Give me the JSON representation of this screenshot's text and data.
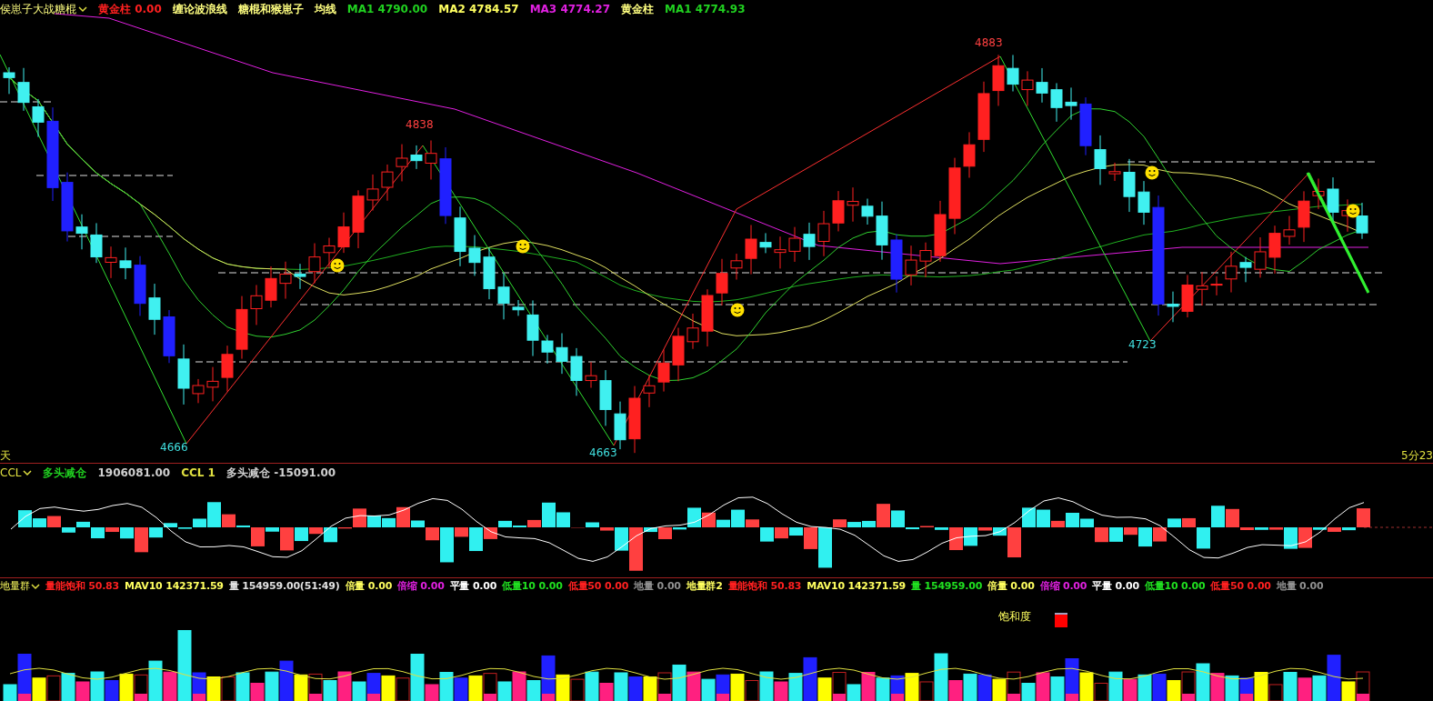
{
  "main_panel": {
    "selector": "侯崽子大战糖棍",
    "legend": [
      {
        "text": "黄金柱 0.00",
        "color": "#ff2020"
      },
      {
        "text": "缠论波浪线",
        "color": "#ffff80"
      },
      {
        "text": "糖棍和猴崽子",
        "color": "#ffff80"
      },
      {
        "text": "均线",
        "color": "#ffff80"
      },
      {
        "text": "MA1 4790.00",
        "color": "#20d020"
      },
      {
        "text": "MA2 4784.57",
        "color": "#ffff60"
      },
      {
        "text": "MA3 4774.27",
        "color": "#e020e0"
      },
      {
        "text": "黄金柱",
        "color": "#ffff80"
      },
      {
        "text": "MA1 4774.93",
        "color": "#20d020"
      }
    ],
    "price_labels": [
      {
        "text": "4883",
        "color": "#ff4040"
      },
      {
        "text": "4838",
        "color": "#ff4040"
      },
      {
        "text": "4666",
        "color": "#40e0e0"
      },
      {
        "text": "4663",
        "color": "#40e0e0"
      },
      {
        "text": "4723",
        "color": "#40e0e0"
      }
    ],
    "period_label": "天",
    "timer": "5分23"
  },
  "ccl_panel": {
    "selector": "CCL",
    "legend": [
      {
        "text": "多头减仓",
        "color": "#20d020"
      },
      {
        "text": "1906081.00",
        "color": "#d0d0d0"
      },
      {
        "text": "CCL 1",
        "color": "#e0e040"
      },
      {
        "text": "多头减仓 -15091.00",
        "color": "#d0d0d0"
      }
    ]
  },
  "volume_panel": {
    "selector": "地量群",
    "legend": [
      {
        "text": "量能饱和 50.83",
        "color": "#ff2020"
      },
      {
        "text": "MAV10 142371.59",
        "color": "#ffff60"
      },
      {
        "text": "量 154959.00(51:49)",
        "color": "#e0e0e0"
      },
      {
        "text": "倍量 0.00",
        "color": "#ffff60"
      },
      {
        "text": "倍缩 0.00",
        "color": "#e020e0"
      },
      {
        "text": "平量 0.00",
        "color": "#ffffff"
      },
      {
        "text": "低量10 0.00",
        "color": "#20e020"
      },
      {
        "text": "低量50 0.00",
        "color": "#ff2020"
      },
      {
        "text": "地量 0.00",
        "color": "#909090"
      },
      {
        "text": "地量群2",
        "color": "#ffff60"
      },
      {
        "text": "量能饱和 50.83",
        "color": "#ff2020"
      },
      {
        "text": "MAV10 142371.59",
        "color": "#ffff60"
      },
      {
        "text": "量 154959.00",
        "color": "#20e020"
      },
      {
        "text": "倍量 0.00",
        "color": "#ffff60"
      },
      {
        "text": "倍缩 0.00",
        "color": "#e020e0"
      },
      {
        "text": "平量 0.00",
        "color": "#ffffff"
      },
      {
        "text": "低量10 0.00",
        "color": "#20e020"
      },
      {
        "text": "低量50 0.00",
        "color": "#ff2020"
      },
      {
        "text": "地量 0.00",
        "color": "#909090"
      }
    ],
    "saturation_label": "饱和度"
  }
}
